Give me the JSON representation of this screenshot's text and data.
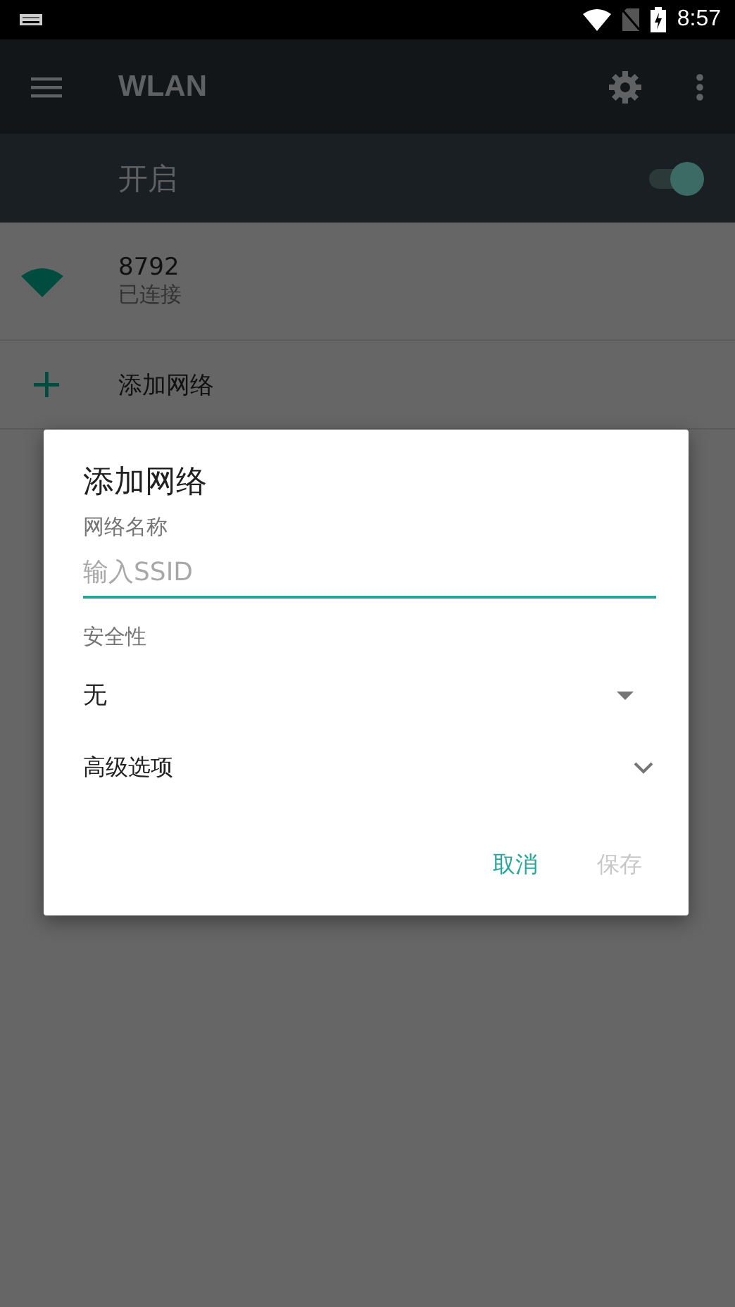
{
  "status_bar": {
    "time": "8:57"
  },
  "app_bar": {
    "title": "WLAN"
  },
  "master_switch": {
    "label": "开启",
    "on": true
  },
  "networks": [
    {
      "name": "8792",
      "status": "已连接"
    }
  ],
  "add_network": {
    "label": "添加网络"
  },
  "dialog": {
    "title": "添加网络",
    "name_label": "网络名称",
    "ssid_placeholder": "输入SSID",
    "security_label": "安全性",
    "security_value": "无",
    "advanced": {
      "label": "高级选项",
      "expanded": false
    },
    "buttons": [
      {
        "label": "取消",
        "disabled": false
      },
      {
        "label": "保存",
        "disabled": true
      }
    ]
  }
}
